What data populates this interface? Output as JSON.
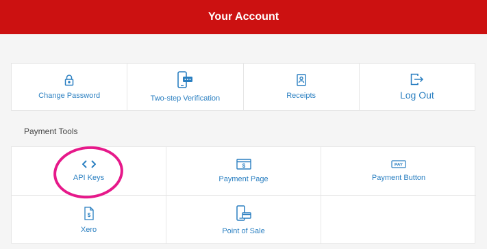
{
  "header": {
    "title": "Your Account"
  },
  "account_actions": [
    {
      "label": "Change Password",
      "icon": "lock-icon"
    },
    {
      "label": "Two-step Verification",
      "icon": "phone-verification-icon"
    },
    {
      "label": "Receipts",
      "icon": "receipt-icon"
    },
    {
      "label": "Log Out",
      "icon": "logout-icon"
    }
  ],
  "payment_tools": {
    "title": "Payment Tools",
    "items": [
      {
        "label": "API Keys",
        "icon": "code-icon"
      },
      {
        "label": "Payment Page",
        "icon": "payment-page-icon"
      },
      {
        "label": "Payment Button",
        "icon": "pay-button-icon",
        "icon_text": "PAY"
      },
      {
        "label": "Xero",
        "icon": "document-dollar-icon"
      },
      {
        "label": "Point of Sale",
        "icon": "pos-icon"
      }
    ]
  },
  "colors": {
    "header": "#cc1111",
    "link": "#2a7fc1",
    "highlight": "#e6198a"
  }
}
